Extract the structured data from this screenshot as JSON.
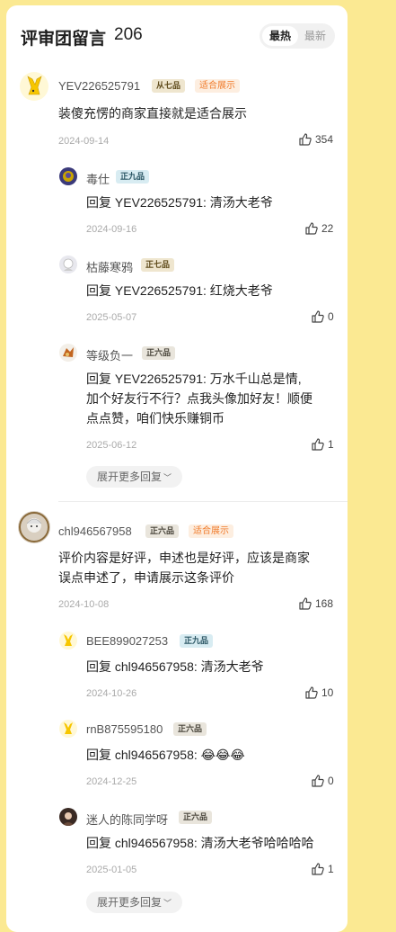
{
  "header": {
    "title": "评审团留言",
    "count": "206",
    "sort_active": "最热",
    "sort_other": "最新"
  },
  "c1": {
    "user": "YEV226525791",
    "rank": "从七品",
    "tag": "适合展示",
    "text": "装傻充愣的商家直接就是适合展示",
    "date": "2024-09-14",
    "likes": "354",
    "replies": [
      {
        "user": "毒仕",
        "rank": "正九品",
        "text": "回复 YEV226525791: 清汤大老爷",
        "date": "2024-09-16",
        "likes": "22"
      },
      {
        "user": "枯藤寒鸦",
        "rank": "正七品",
        "text": "回复 YEV226525791: 红烧大老爷",
        "date": "2025-05-07",
        "likes": "0"
      },
      {
        "user": "等级负一",
        "rank": "正六品",
        "text1": "回复 YEV226525791: 万水千山总是情,",
        "text2": "加个好友行不行？点我头像加好友！顺便",
        "text3": "点点赞，咱们快乐赚铜币",
        "date": "2025-06-12",
        "likes": "1"
      }
    ],
    "expand": "展开更多回复"
  },
  "c2": {
    "user": "chl946567958",
    "rank": "正六品",
    "tag": "适合展示",
    "text1": "评价内容是好评，申述也是好评，应该是商家",
    "text2": "误点申述了，申请展示这条评价",
    "date": "2024-10-08",
    "likes": "168",
    "replies": [
      {
        "user": "BEE899027253",
        "rank": "正九品",
        "text": "回复 chl946567958: 清汤大老爷",
        "date": "2024-10-26",
        "likes": "10"
      },
      {
        "user": "rnB875595180",
        "rank": "正六品",
        "text": "回复 chl946567958: 😂😂😂",
        "date": "2024-12-25",
        "likes": "0"
      },
      {
        "user": "迷人的陈同学呀",
        "rank": "正六品",
        "text": "回复 chl946567958: 清汤大老爷哈哈哈哈",
        "date": "2025-01-05",
        "likes": "1"
      }
    ],
    "expand": "展开更多回复"
  }
}
